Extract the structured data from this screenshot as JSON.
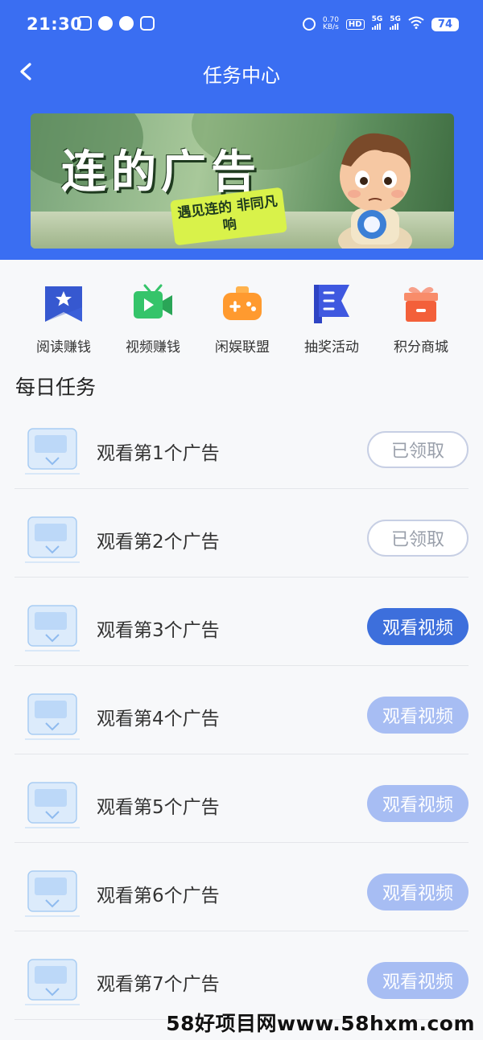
{
  "status_bar": {
    "time": "21:30",
    "net_speed_value": "0.70",
    "net_speed_unit": "KB/s",
    "hd_label": "HD",
    "signal1": "5G",
    "signal2": "5G",
    "battery": "74"
  },
  "nav": {
    "title": "任务中心",
    "back_icon": "chevron-left-icon"
  },
  "banner": {
    "headline": "连的广告",
    "tag": "遇见连的 非同凡响"
  },
  "quick_links": [
    {
      "label": "阅读赚钱",
      "icon": "book-star-icon",
      "color": "#3b5fd9"
    },
    {
      "label": "视频赚钱",
      "icon": "video-camera-icon",
      "color": "#35c46a"
    },
    {
      "label": "闲娱联盟",
      "icon": "gamepad-icon",
      "color": "#ff9a2f"
    },
    {
      "label": "抽奖活动",
      "icon": "flag-list-icon",
      "color": "#3f58e0"
    },
    {
      "label": "积分商城",
      "icon": "gift-box-icon",
      "color": "#f3603a"
    }
  ],
  "daily": {
    "title": "每日任务",
    "tasks": [
      {
        "name": "观看第1个广告",
        "button": "已领取",
        "state": "claimed"
      },
      {
        "name": "观看第2个广告",
        "button": "已领取",
        "state": "claimed"
      },
      {
        "name": "观看第3个广告",
        "button": "观看视频",
        "state": "active"
      },
      {
        "name": "观看第4个广告",
        "button": "观看视频",
        "state": "disabled"
      },
      {
        "name": "观看第5个广告",
        "button": "观看视频",
        "state": "disabled"
      },
      {
        "name": "观看第6个广告",
        "button": "观看视频",
        "state": "disabled"
      },
      {
        "name": "观看第7个广告",
        "button": "观看视频",
        "state": "disabled"
      }
    ]
  },
  "watermark": "58好项目网www.58hxm.com"
}
